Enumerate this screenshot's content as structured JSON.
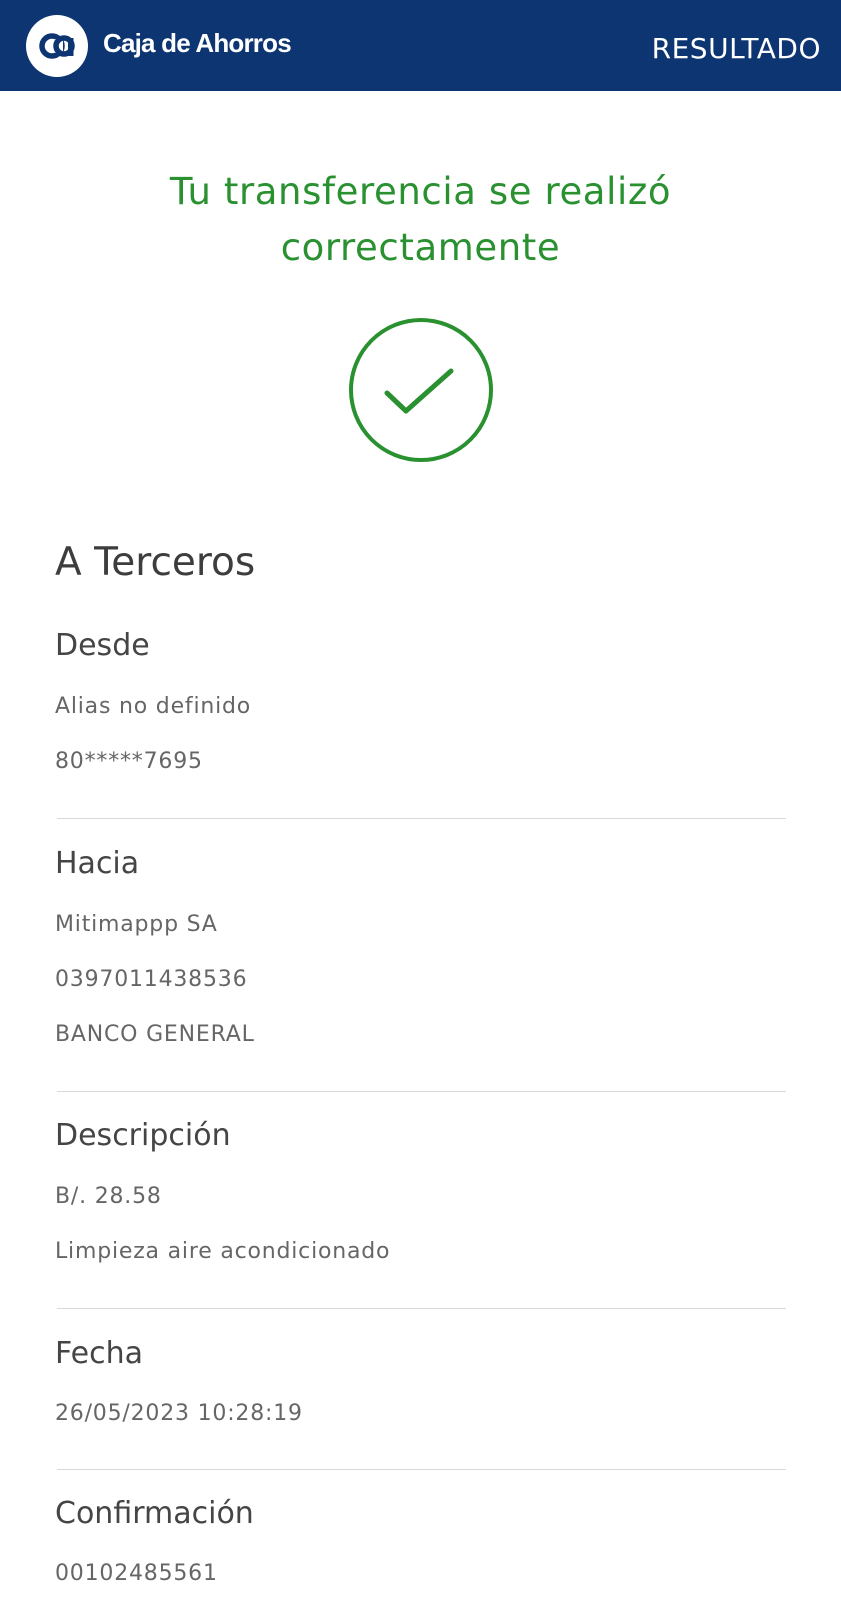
{
  "header": {
    "brand": "Caja de Ahorros",
    "logo_text": "ca",
    "title": "RESULTADO",
    "background_color": "#0c3571"
  },
  "success": {
    "line1": "Tu transferencia se realizó",
    "line2": "correctamente",
    "color": "#2a9131",
    "icon": "check-circle-icon"
  },
  "section": {
    "title": "A Terceros"
  },
  "desde": {
    "label": "Desde",
    "alias": "Alias no definido",
    "account": "80*****7695"
  },
  "hacia": {
    "label": "Hacia",
    "name": "Mitimappp SA",
    "account": "0397011438536",
    "bank": "BANCO GENERAL"
  },
  "descripcion": {
    "label": "Descripción",
    "amount": "B/. 28.58",
    "text": "Limpieza aire acondicionado"
  },
  "fecha": {
    "label": "Fecha",
    "value": "26/05/2023 10:28:19"
  },
  "confirmacion": {
    "label": "Confirmación",
    "value": "00102485561"
  }
}
